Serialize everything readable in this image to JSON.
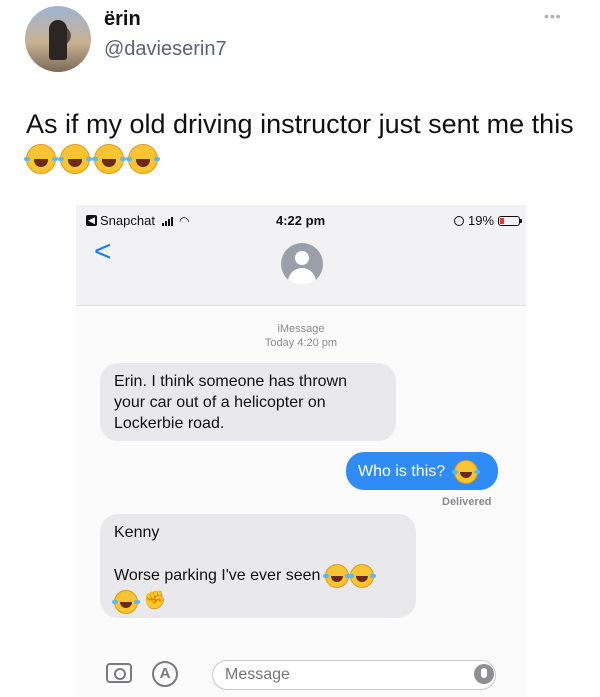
{
  "tweet": {
    "display_name": "ërin",
    "handle": "@davieserin7",
    "text": "As if my old driving instructor just sent me this",
    "emojis": [
      "joy-emoji",
      "joy-emoji",
      "joy-emoji",
      "joy-emoji"
    ],
    "more_icon": "more-dots-icon"
  },
  "phone": {
    "status_bar": {
      "back_app": "Snapchat",
      "time": "4:22 pm",
      "battery": "19%"
    },
    "thread": {
      "service": "iMessage",
      "timestamp": "Today 4:20 pm"
    },
    "messages": [
      {
        "direction": "received",
        "text": "Erin. I think someone has thrown your car out of a helicopter on Lockerbie road."
      },
      {
        "direction": "sent",
        "text": "Who is this?",
        "status": "Delivered"
      },
      {
        "direction": "received",
        "line1": "Kenny",
        "line2": "Worse parking I've ever seen"
      }
    ],
    "composer": {
      "placeholder": "Message"
    }
  },
  "colors": {
    "sent_bubble": "#2f8cf6",
    "received_bubble": "#e9e9eb",
    "ios_blue": "#1a7cf5"
  }
}
